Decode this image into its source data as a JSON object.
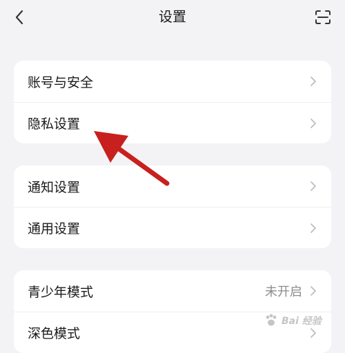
{
  "header": {
    "title": "设置",
    "back_icon": "chevron-left-icon",
    "scan_icon": "scan-icon"
  },
  "groups": [
    {
      "items": [
        {
          "label": "账号与安全"
        },
        {
          "label": "隐私设置"
        }
      ]
    },
    {
      "items": [
        {
          "label": "通知设置"
        },
        {
          "label": "通用设置"
        }
      ]
    },
    {
      "items": [
        {
          "label": "青少年模式",
          "value": "未开启"
        },
        {
          "label": "深色模式"
        }
      ]
    }
  ],
  "annotation": {
    "color": "#c8201e"
  },
  "watermark": {
    "text": "Bai 经验"
  }
}
